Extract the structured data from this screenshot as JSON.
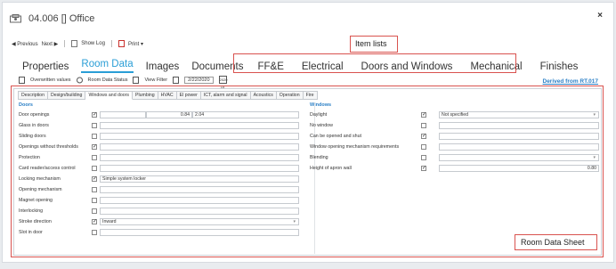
{
  "window": {
    "title": "04.006 [] Office",
    "close_glyph": "×"
  },
  "nav": {
    "previous": "◀ Previous",
    "next": "Next ▶",
    "show_log": "Show Log",
    "print": "Print ▾"
  },
  "tabs": [
    "Properties",
    "Room Data",
    "Images",
    "Documents"
  ],
  "item_tabs": [
    "FF&E",
    "Electrical",
    "Doors and Windows",
    "Mechanical",
    "Finishes"
  ],
  "annotations": {
    "item_lists": "Item lists",
    "room_data_sheet": "Room Data Sheet",
    "color": "#d9534f"
  },
  "toolbar": {
    "overwritten_values": "Overwritten values",
    "room_data_status": "Room Data Status",
    "view_filter": "View Filter",
    "date": "2/22/2020",
    "cal_label": "2020 15"
  },
  "derived_link": "Derived from RT.017",
  "subtabs": [
    "Description",
    "Design/building",
    "Windows and doors",
    "Plumbing",
    "HVAC",
    "El power",
    "ICT, alarm and signal",
    "Acoustics",
    "Operation",
    "Fire"
  ],
  "doors": {
    "title": "Doors",
    "rows": [
      {
        "label": "Door openings",
        "checked": true,
        "value": "",
        "v1": "0.84",
        "v2": "2.04"
      },
      {
        "label": "Glass in doors",
        "checked": false,
        "value": ""
      },
      {
        "label": "Sliding doors",
        "checked": false,
        "value": ""
      },
      {
        "label": "Openings without thresholds",
        "checked": true,
        "value": ""
      },
      {
        "label": "Protection",
        "checked": false,
        "value": ""
      },
      {
        "label": "Card reader/access control",
        "checked": false,
        "value": ""
      },
      {
        "label": "Locking mechanism",
        "checked": true,
        "value": "Simple system locker"
      },
      {
        "label": "Opening mechanism",
        "checked": false,
        "value": ""
      },
      {
        "label": "Magnet opening",
        "checked": false,
        "value": ""
      },
      {
        "label": "Interlocking",
        "checked": false,
        "value": ""
      },
      {
        "label": "Stroke direction",
        "checked": true,
        "value": "Inward"
      },
      {
        "label": "Slot in door",
        "checked": false,
        "value": ""
      }
    ]
  },
  "windows": {
    "title": "Windows",
    "rows": [
      {
        "label": "Daylight",
        "checked": true,
        "value": "Not specified"
      },
      {
        "label": "No window",
        "checked": false,
        "value": ""
      },
      {
        "label": "Can be opened and shut",
        "checked": true,
        "value": ""
      },
      {
        "label": "Window opening mechanism requirements",
        "checked": false,
        "value": ""
      },
      {
        "label": "Blending",
        "checked": false,
        "value": ""
      },
      {
        "label": "Height of apron wall",
        "checked": true,
        "value": "0.80"
      }
    ]
  },
  "check_glyph": "✓",
  "colors": {
    "accent": "#2a9ed6",
    "link": "#2a7fc6"
  }
}
